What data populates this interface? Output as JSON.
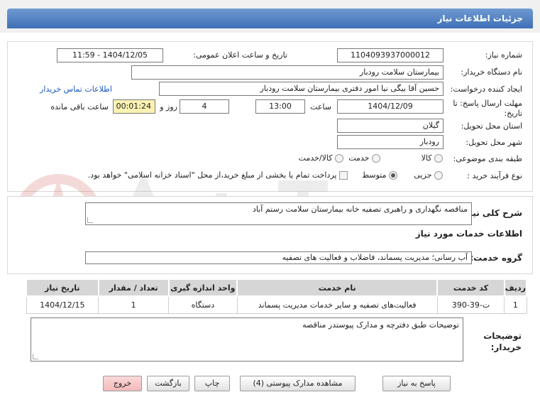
{
  "header": {
    "title": "جزئیات اطلاعات نیاز"
  },
  "form": {
    "need_number_label": "شماره نیاز:",
    "need_number": "1104093937000012",
    "announce_label": "تاریخ و ساعت اعلان عمومی:",
    "announce_value": "1404/12/05 - 11:59",
    "buyer_org_label": "نام دستگاه خریدار:",
    "buyer_org": "بیمارستان سلامت رودبار",
    "creator_label": "ایجاد کننده درخواست:",
    "creator": "حسین آقا بیگی نیا امور دفتری بیمارستان سلامت رودبار",
    "contact_link": "اطلاعات تماس خریدار",
    "deadline_label_1": "مهلت ارسال پاسخ: تا",
    "deadline_label_2": "تاریخ:",
    "deadline_date": "1404/12/09",
    "time_label": "ساعت",
    "deadline_time": "13:00",
    "days_value": "4",
    "days_label": "روز و",
    "remaining_time": "00:01:24",
    "remaining_label": "ساعت باقی مانده",
    "province_label": "استان محل تحویل:",
    "province": "گیلان",
    "city_label": "شهر محل تحویل:",
    "city": "رودبار",
    "category_label": "طبقه بندی موضوعی:",
    "category_options": [
      "کالا",
      "خدمت",
      "کالا/خدمت"
    ],
    "category_selected": 1,
    "process_label": "نوع فرآیند خرید :",
    "process_options": [
      "جزیی",
      "متوسط"
    ],
    "process_selected": 1,
    "treasury_note": "پرداخت تمام یا بخشی از مبلغ خرید،از محل \"اسناد خزانه اسلامی\" خواهد بود."
  },
  "description": {
    "label": "شرح کلی نیاز:",
    "value": "مناقصه نگهداری و راهبری تصفیه خانه بیمارستان سلامت رستم آباد"
  },
  "services": {
    "section_title": "اطلاعات خدمات مورد نیاز",
    "group_label": "گروه خدمت:",
    "group_value": "آب رسانی؛ مدیریت پسماند، فاضلاب و فعالیت های تصفیه",
    "columns": [
      "ردیف",
      "کد خدمت",
      "نام خدمت",
      "واحد اندازه گیری",
      "تعداد / مقدار",
      "تاریخ نیاز"
    ],
    "rows": [
      [
        "1",
        "ت-39-390",
        "فعالیت‌های تصفیه و سایر خدمات مدیریت پسماند",
        "دستگاه",
        "1",
        "1404/12/15"
      ]
    ]
  },
  "buyer_notes": {
    "label_1": "توضیحات",
    "label_2": "خریدار:",
    "value": "توضیحات طبق دفترچه و مدارک پیوستدر مناقصه"
  },
  "buttons": {
    "reply": "پاسخ به نیاز",
    "attachments": "مشاهده مدارک پیوستی (4)",
    "print": "چاپ",
    "back": "بازگشت",
    "exit": "خروج"
  },
  "colors": {
    "header_blue": "#3f70b6",
    "link_blue": "#1a56c6",
    "highlight_yellow": "#fbf1b2",
    "exit_pink": "#f2b9b9",
    "watermark_red": "#c0392b"
  }
}
